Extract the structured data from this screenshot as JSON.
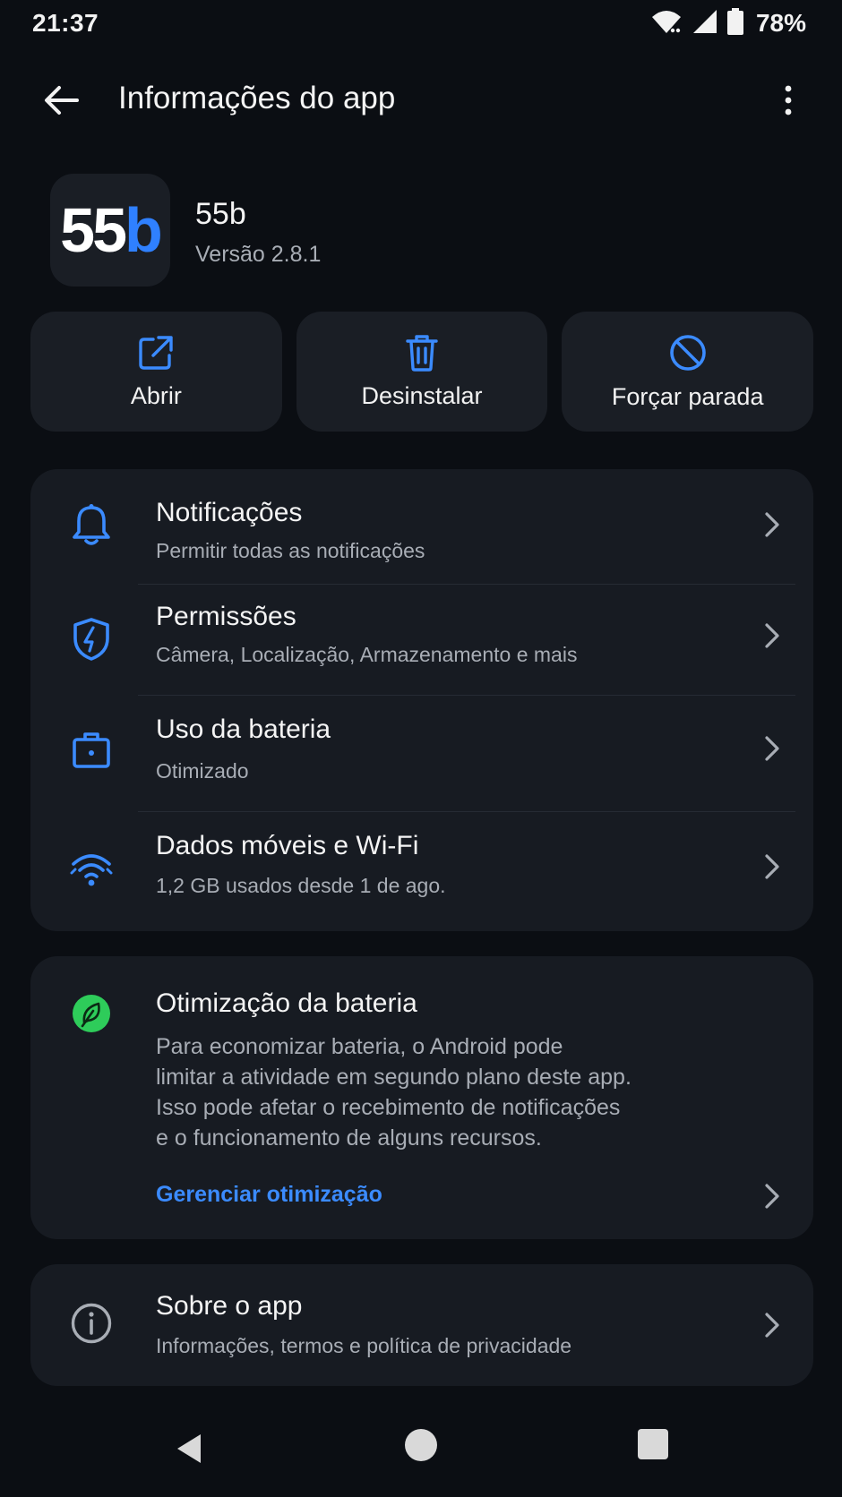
{
  "status_bar": {
    "time": "21:37",
    "battery_percent": "78%",
    "icons": [
      "wifi-icon",
      "signal-icon",
      "battery-icon"
    ]
  },
  "app_bar": {
    "title": "Informações do app",
    "back_icon": "arrow-left-icon",
    "more_icon": "more-vertical-icon"
  },
  "app": {
    "icon_text_number": "55",
    "icon_text_letter": "b",
    "name": "55b",
    "version": "Versão 2.8.1"
  },
  "actions": [
    {
      "label": "Abrir",
      "icon": "open-external-icon"
    },
    {
      "label": "Desinstalar",
      "icon": "trash-icon"
    },
    {
      "label": "Forçar parada",
      "icon": "block-icon"
    }
  ],
  "settings": [
    {
      "title": "Notificações",
      "subtitle": "Permitir todas as notificações",
      "icon": "bell-icon"
    },
    {
      "title": "Permissões",
      "subtitle": "Câmera, Localização, Armazenamento e mais",
      "icon": "shield-icon"
    },
    {
      "title": "Uso da bateria",
      "subtitle": "Otimizado",
      "icon": "briefcase-battery-icon"
    },
    {
      "title": "Dados móveis e Wi-Fi",
      "subtitle": "1,2 GB usados desde 1 de ago.",
      "icon": "wifi-data-icon"
    }
  ],
  "optimization": {
    "title": "Otimização da bateria",
    "body_lines": [
      "Para economizar bateria, o Android pode",
      "limitar a atividade em segundo plano deste app.",
      "Isso pode afetar o recebimento de notificações",
      "e o funcionamento de alguns recursos."
    ],
    "link": "Gerenciar otimização",
    "icon": "leaf-icon"
  },
  "about": {
    "title": "Sobre o app",
    "subtitle": "Informações, termos e política de privacidade",
    "icon": "info-icon"
  },
  "colors": {
    "background": "#0b0e13",
    "card": "#171b22",
    "accent_blue": "#2f80ff",
    "link_blue": "#3b8bff",
    "leaf_green": "#2ecc5a",
    "secondary_text": "#a8adb5"
  },
  "nav_bar": {
    "icons": [
      "nav-back-icon",
      "nav-home-icon",
      "nav-recents-icon"
    ]
  }
}
